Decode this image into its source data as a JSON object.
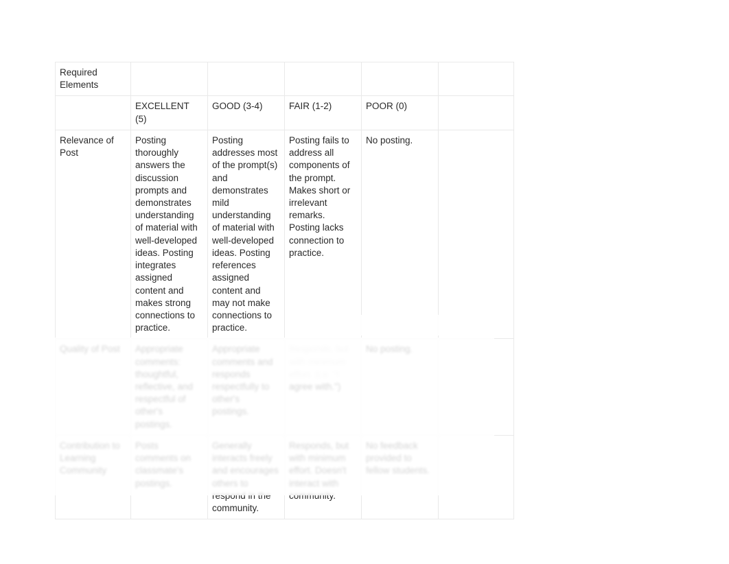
{
  "rubric": {
    "header": {
      "criteria_label": "Required Elements",
      "excellent": "EXCELLENT (5)",
      "good": "GOOD (3-4)",
      "fair": "FAIR (1-2)",
      "poor": "POOR (0)"
    },
    "rows": [
      {
        "criteria": "Relevance of Post",
        "excellent": "Posting thoroughly answers the discussion prompts and demonstrates understanding of material with well-developed ideas. Posting integrates assigned content and makes strong connections to practice.",
        "good": "Posting addresses most of the prompt(s) and demonstrates mild understanding of material with well-developed ideas. Posting references assigned content and may not make connections to practice.",
        "fair": "Posting fails to address all components of the prompt. Makes short or irrelevant remarks. Posting lacks connection to practice.",
        "poor": "No posting."
      },
      {
        "criteria": "Quality of Post",
        "excellent": "Appropriate comments: thoughtful, reflective, and respectful of other's postings.",
        "good": "Appropriate comments and responds respectfully to other's postings.",
        "fair": "Responds, but with minimum effort. (i.e. \"I agree with.\")",
        "poor": "No posting."
      },
      {
        "criteria": "Contribution to Learning Community",
        "excellent": "Posts comments on classmate's postings.",
        "good": "Generally interacts freely and encourages others to respond in the community.",
        "fair": "Responds, but with minimum effort. Doesn't interact with community.",
        "poor": "No feedback provided to fellow students.",
        "last_col": ""
      }
    ]
  }
}
